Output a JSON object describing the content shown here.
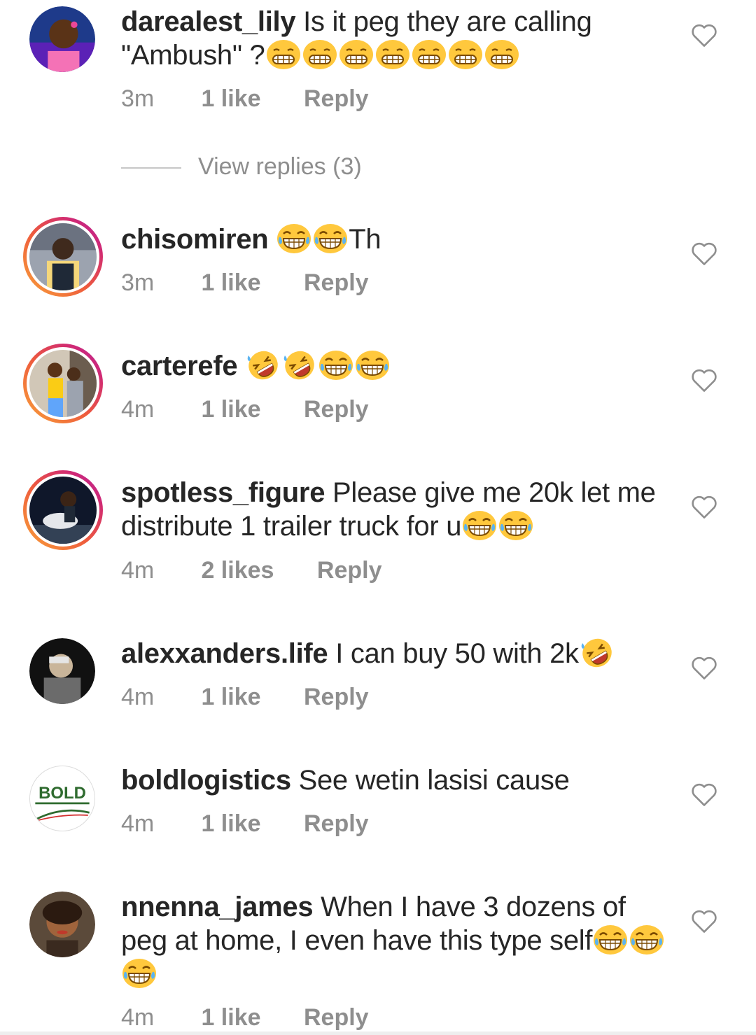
{
  "comments": [
    {
      "username": "darealest_lily",
      "text_before": "Is  it peg they are calling \"Ambush\" ?",
      "emoji_count": 7,
      "emoji_type": "grimacing-face",
      "time": "3m",
      "likes": "1 like",
      "reply_label": "Reply",
      "avatar_icon": "profile-photo"
    },
    {
      "username": "chisomiren",
      "text_before": "",
      "emoji_count": 2,
      "emoji_type": "tears-of-joy-face",
      "text_after": "Th",
      "time": "3m",
      "likes": "1 like",
      "reply_label": "Reply",
      "avatar_icon": "profile-photo"
    },
    {
      "username": "carterefe",
      "text_before": "",
      "emoji_sequence": [
        "rofl-face",
        "rofl-face",
        "tears-of-joy-face",
        "tears-of-joy-face"
      ],
      "time": "4m",
      "likes": "1 like",
      "reply_label": "Reply",
      "avatar_icon": "profile-photo"
    },
    {
      "username": "spotless_figure",
      "text_before": "Please give me 20k let me distribute 1 trailer truck for u",
      "emoji_count": 2,
      "emoji_type": "tears-of-joy-face",
      "time": "4m",
      "likes": "2 likes",
      "reply_label": "Reply",
      "avatar_icon": "profile-photo"
    },
    {
      "username": "alexxanders.life",
      "text_before": "I can buy 50 with 2k",
      "emoji_count": 1,
      "emoji_type": "rofl-face",
      "time": "4m",
      "likes": "1 like",
      "reply_label": "Reply",
      "avatar_icon": "profile-photo"
    },
    {
      "username": "boldlogistics",
      "text_before": "See wetin lasisi cause",
      "time": "4m",
      "likes": "1 like",
      "reply_label": "Reply",
      "avatar_icon": "bold-logo",
      "logo_text": "BOLD"
    },
    {
      "username": "nnenna_james",
      "text_before": "When I have 3 dozens of peg at home, I even have this type self",
      "emoji_count": 3,
      "emoji_type": "tears-of-joy-face",
      "time": "4m",
      "likes": "1 like",
      "reply_label": "Reply",
      "avatar_icon": "profile-photo"
    }
  ],
  "view_replies": "View replies (3)",
  "colors": {
    "text": "#262626",
    "meta": "#8e8e8e",
    "emoji_yellow": "#ffc83d",
    "story_ring": "#ee5b3c"
  }
}
